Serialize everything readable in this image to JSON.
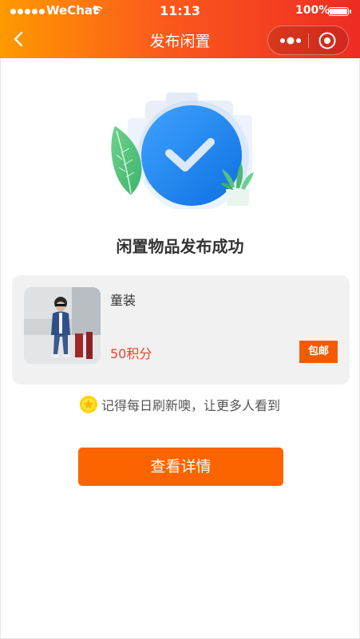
{
  "status_bar": {
    "carrier": "WeChat",
    "time": "11:13",
    "battery": "100%"
  },
  "nav": {
    "title": "发布闲置"
  },
  "result": {
    "title": "闲置物品发布成功"
  },
  "item": {
    "name": "童装",
    "price": "50积分",
    "badge": "包邮"
  },
  "tip": {
    "text": "记得每日刷新噢，让更多人看到"
  },
  "actions": {
    "detail_label": "查看详情"
  },
  "colors": {
    "header_start": "#ff9a00",
    "header_end": "#ee2b24",
    "button": "#fb6400",
    "price": "#e8432a",
    "badge": "#f55a00",
    "check_circle": "#1f86f0"
  }
}
